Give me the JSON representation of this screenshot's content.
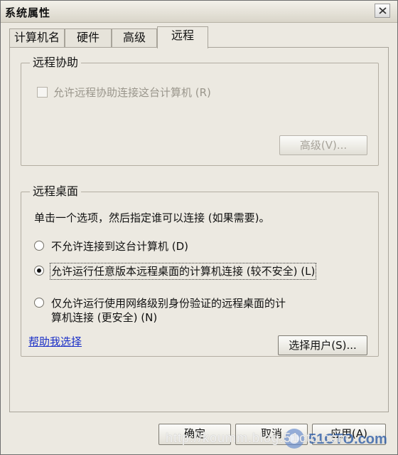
{
  "window": {
    "title": "系统属性"
  },
  "tabs": [
    {
      "label": "计算机名",
      "active": false
    },
    {
      "label": "硬件",
      "active": false
    },
    {
      "label": "高级",
      "active": false
    },
    {
      "label": "远程",
      "active": true
    }
  ],
  "remote_assistance": {
    "group_title": "远程协助",
    "checkbox_label": "允许远程协助连接这台计算机 (R)",
    "checkbox_checked": false,
    "checkbox_disabled": true,
    "advanced_button": "高级(V)..."
  },
  "remote_desktop": {
    "group_title": "远程桌面",
    "instruction": "单击一个选项，然后指定谁可以连接 (如果需要)。",
    "options": [
      {
        "label": "不允许连接到这台计算机 (D)",
        "checked": false
      },
      {
        "label": "允许运行任意版本远程桌面的计算机连接 (较不安全) (L)",
        "checked": true
      },
      {
        "label_line1": "仅允许运行使用网络级别身份验证的远程桌面的计",
        "label_line2": "算机连接 (更安全) (N)",
        "checked": false
      }
    ],
    "help_link": "帮助我选择",
    "select_users_button": "选择用户(S)..."
  },
  "footer": {
    "ok_button": "确定",
    "cancel_button": "取消",
    "apply_button": "应用(A)"
  },
  "watermark": "http://koumm.blog.51cto.com",
  "logo_text": "51CTO.com",
  "colors": {
    "window_bg": "#ece9e1",
    "link": "#1a2fc7",
    "disabled_text": "#9a968c"
  }
}
